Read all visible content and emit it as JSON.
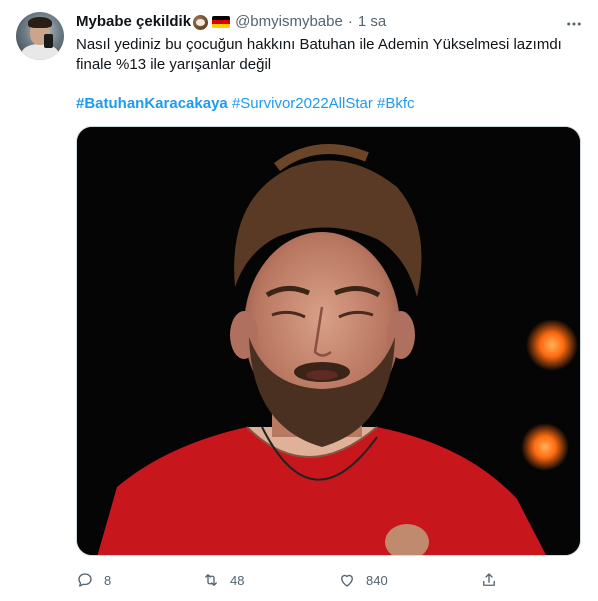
{
  "tweet": {
    "author_name": "Mybabe çekildik",
    "author_handle": "@bmyismybabe",
    "separator": "·",
    "time": "1 sa",
    "text": "Nasıl yediniz bu çocuğun hakkını Batuhan ile Ademin Yükselmesi lazımdı\nfinale %13 ile yarışanlar değil",
    "hashtags": [
      "#BatuhanKaracakaya",
      "#Survivor2022AllStar",
      "#Bkfc"
    ],
    "emoji_icons": [
      "coconut-emoji-icon",
      "germany-flag-icon"
    ],
    "flag_colors": [
      "#000000",
      "#dd0000",
      "#ffce00"
    ]
  },
  "actions": {
    "reply_count": "8",
    "retweet_count": "48",
    "like_count": "840"
  },
  "media": {
    "description_icon": "photo-crying-man",
    "accent_colors": {
      "shirt": "#c8161d",
      "background": "#050505",
      "lights": "#ff7a1a"
    }
  },
  "colors": {
    "text": "#0f1419",
    "secondary": "#536471",
    "link": "#1d9bf0",
    "border": "#cfd9de"
  }
}
